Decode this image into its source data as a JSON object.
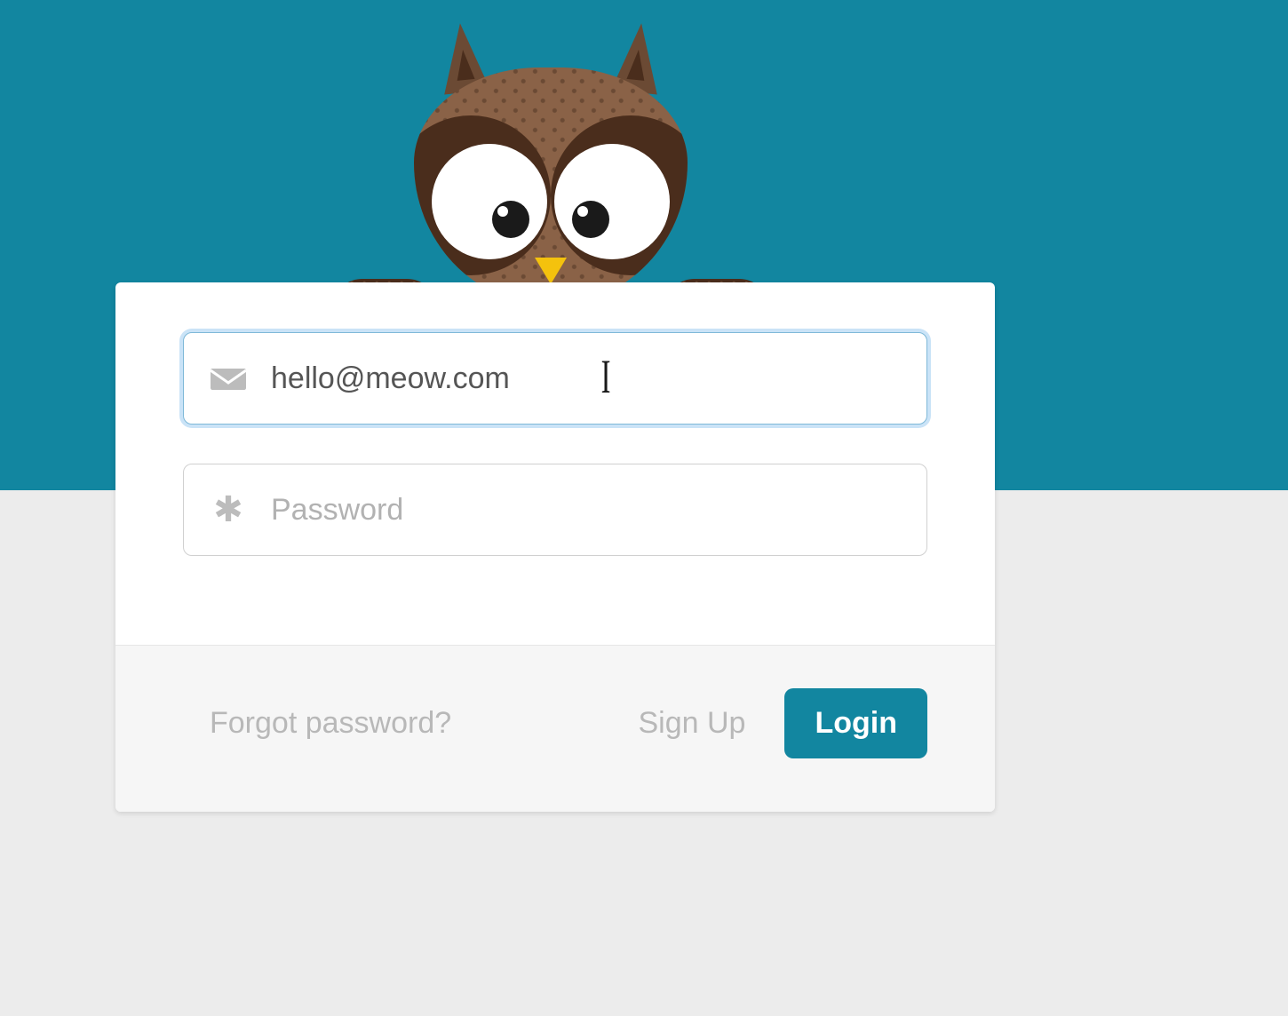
{
  "colors": {
    "accent": "#1286a0",
    "page_bg": "#ececec",
    "card_bg": "#ffffff",
    "footer_bg": "#f6f6f6",
    "muted_text": "#b8b8b8",
    "input_text": "#555555"
  },
  "mascot": "owl",
  "form": {
    "email": {
      "icon": "envelope-icon",
      "value": "hello@meow.com",
      "placeholder": "",
      "focused": true
    },
    "password": {
      "icon": "asterisk-icon",
      "value": "",
      "placeholder": "Password",
      "focused": false
    }
  },
  "footer": {
    "forgot_label": "Forgot password?",
    "signup_label": "Sign Up",
    "login_label": "Login"
  }
}
